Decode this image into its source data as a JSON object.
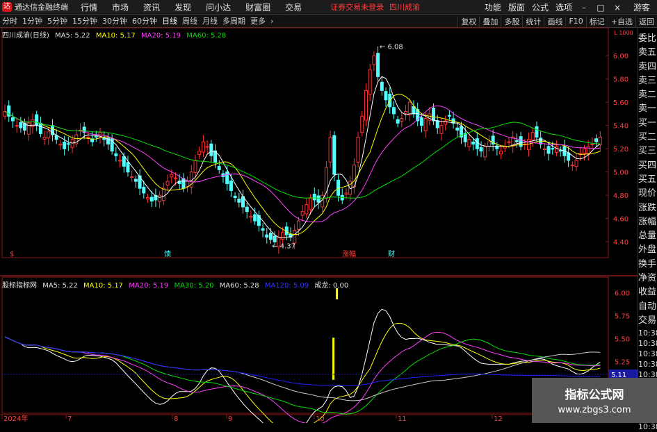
{
  "app": {
    "title": "通达信金融终端",
    "warning": "证券交易未登录",
    "stock_name": "四川成渝",
    "guest": "游客"
  },
  "menu": [
    "行情",
    "市场",
    "资讯",
    "发现",
    "问小达",
    "财富圈",
    "交易"
  ],
  "topright": [
    "功能",
    "版面",
    "公式",
    "选项"
  ],
  "periods": [
    "分时",
    "1分钟",
    "5分钟",
    "15分钟",
    "30分钟",
    "60分钟",
    "日线",
    "周线",
    "月线",
    "多周期",
    "更多"
  ],
  "active_period": "日线",
  "tools": [
    "复权",
    "叠加",
    "多股",
    "统计",
    "画线",
    "F10",
    "标记",
    "+自选",
    "返回"
  ],
  "main_chart": {
    "legend": {
      "name": "四川成渝(日线)",
      "ma5": "MA5: 5.22",
      "ma10": "MA10: 5.17",
      "ma20": "MA20: 5.19",
      "ma60": "MA60: 5.28"
    },
    "ymin": 4.3,
    "ymax": 6.15,
    "ticks": [
      "6.00",
      "5.80",
      "5.60",
      "5.40",
      "5.20",
      "5.00",
      "4.80",
      "4.60",
      "4.40"
    ],
    "high_label": "6.08",
    "low_label": "4.37",
    "markers": [
      "$",
      "馈",
      "涨幅",
      "财"
    ],
    "unit_label": "L 1000"
  },
  "sub_chart": {
    "legend": {
      "name": "股标指标网",
      "ma5": "MA5: 5.22",
      "ma10": "MA10: 5.17",
      "ma20": "MA20: 5.19",
      "ma30": "MA30: 5.20",
      "ma60": "MA60: 5.28",
      "ma120": "MA120: 5.09",
      "cl": "成龙: 0.00"
    },
    "ticks": [
      "6.00",
      "5.75",
      "5.50",
      "5.25",
      "5.00",
      "4.75"
    ],
    "current": "5.11"
  },
  "x_axis": [
    "2024年",
    "7",
    "8",
    "9",
    "10",
    "11",
    "12"
  ],
  "right_panel": [
    "委比",
    "卖五",
    "卖四",
    "卖三",
    "卖二",
    "卖一",
    "买一",
    "买二",
    "买三",
    "买四",
    "买五",
    "现价",
    "涨跌",
    "涨幅",
    "总量",
    "外盘",
    "换手",
    "净资",
    "收益"
  ],
  "right_panel_lower": [
    "自动",
    "交易"
  ],
  "right_panel_times": [
    "10:38",
    "10:38",
    "10:38",
    "10:38",
    "10:38",
    "10:38",
    "10:38",
    "10:38",
    "10:38",
    "10:38"
  ],
  "watermark": {
    "line1": "指标公式网",
    "line2": "www.zbgs3.com"
  },
  "colors": {
    "up": "#ff3232",
    "down": "#54ffff",
    "ma5": "#ffffff",
    "ma10": "#ffff00",
    "ma20": "#ff40ff",
    "ma60": "#00e000",
    "ma120": "#2222ff"
  }
}
